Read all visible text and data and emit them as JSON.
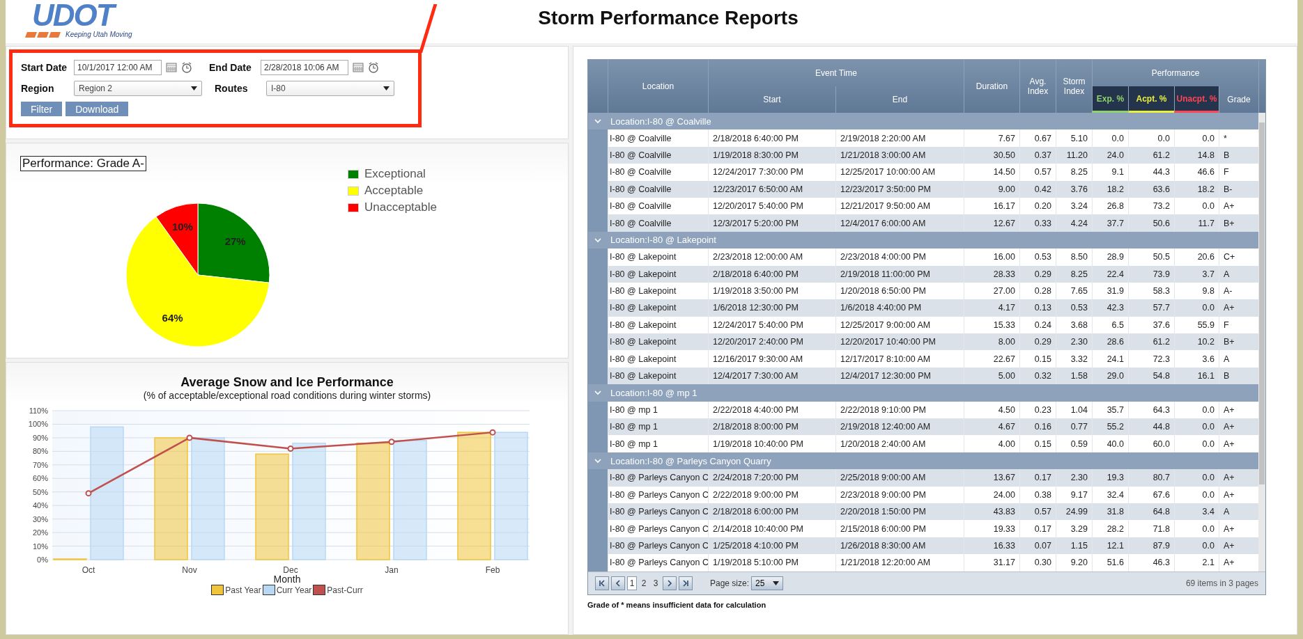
{
  "header": {
    "logo": "UDOT",
    "tagline": "Keeping Utah Moving",
    "title": "Storm Performance Reports"
  },
  "filters": {
    "start_date": {
      "label": "Start Date",
      "value": "10/1/2017 12:00 AM"
    },
    "end_date": {
      "label": "End Date",
      "value": "2/28/2018 10:06 AM"
    },
    "region": {
      "label": "Region",
      "value": "Region 2"
    },
    "routes": {
      "label": "Routes",
      "value": "I-80"
    },
    "buttons": [
      "Filter",
      "Download"
    ],
    "highlighted": true
  },
  "performance": {
    "title": "Performance: Grade A-",
    "chart_data": {
      "type": "pie",
      "categories": [
        "Exceptional",
        "Acceptable",
        "Unacceptable"
      ],
      "values": [
        27,
        64,
        10
      ],
      "value_labels": [
        "27%",
        "64%",
        "10%"
      ]
    },
    "slice_colors": [
      {
        "color": "#008000"
      },
      {
        "color": "#ffff00"
      },
      {
        "color": "#ff0000"
      }
    ]
  },
  "trend": {
    "subtitle": "(% of acceptable/exceptional road conditions during winter storms)",
    "chart_data": {
      "type": "bar",
      "title": "Average Snow and Ice Performance",
      "xlabel": "Month",
      "categories": [
        "Oct",
        "Nov",
        "Dec",
        "Jan",
        "Feb"
      ],
      "series": [
        {
          "name": "Past Year",
          "color": "#f0c43c",
          "type": "bar",
          "values": [
            0.5,
            90,
            78,
            86,
            94
          ]
        },
        {
          "name": "Curr Year",
          "color": "#b8d8f4",
          "type": "bar",
          "values": [
            98,
            90,
            86,
            88,
            94
          ]
        },
        {
          "name": "Past-Curr",
          "color": "#c0504d",
          "type": "line",
          "marker": "circle",
          "values": [
            49,
            90,
            82,
            87,
            94
          ]
        }
      ],
      "grid": true,
      "ylim": [
        0,
        110
      ],
      "yticks": [
        {
          "value": 0,
          "label": "0%"
        },
        {
          "value": 10,
          "label": "10%"
        },
        {
          "value": 20,
          "label": "20%"
        },
        {
          "value": 30,
          "label": "30%"
        },
        {
          "value": 40,
          "label": "40%"
        },
        {
          "value": 50,
          "label": "50%"
        },
        {
          "value": 60,
          "label": "60%"
        },
        {
          "value": 70,
          "label": "70%"
        },
        {
          "value": 80,
          "label": "80%"
        },
        {
          "value": 90,
          "label": "90%"
        },
        {
          "value": 100,
          "label": "100%"
        },
        {
          "value": 110,
          "label": "110%"
        }
      ]
    }
  },
  "table": {
    "columns": [
      {
        "label": "Location"
      },
      {
        "label": "Event Time",
        "subcolumns": [
          {
            "label": "Start"
          },
          {
            "label": "End"
          }
        ]
      },
      {
        "label": "Duration"
      },
      {
        "label": "Avg. Index"
      },
      {
        "label": "Storm Index"
      },
      {
        "label": "Performance",
        "subcolumns": [
          {
            "label": "Exp. %",
            "color": "#8fd36a"
          },
          {
            "label": "Acpt. %",
            "color": "#e8f03a"
          },
          {
            "label": "Unacpt. %",
            "color": "#ff4455"
          },
          {
            "label": "Grade"
          }
        ]
      }
    ],
    "groups": [
      {
        "label": "Location:I-80 @ Coalville",
        "expanded": true,
        "rows": [
          [
            "I-80 @ Coalville",
            "2/18/2018 6:40:00 PM",
            "2/19/2018 2:20:00 AM",
            "7.67",
            "0.67",
            "5.10",
            "0.0",
            "0.0",
            "0.0",
            "*"
          ],
          [
            "I-80 @ Coalville",
            "1/19/2018 8:30:00 PM",
            "1/21/2018 3:00:00 AM",
            "30.50",
            "0.37",
            "11.20",
            "24.0",
            "61.2",
            "14.8",
            "B"
          ],
          [
            "I-80 @ Coalville",
            "12/24/2017 7:30:00 PM",
            "12/25/2017 10:00:00 AM",
            "14.50",
            "0.57",
            "8.25",
            "9.1",
            "44.3",
            "46.6",
            "F"
          ],
          [
            "I-80 @ Coalville",
            "12/23/2017 6:50:00 AM",
            "12/23/2017 3:50:00 PM",
            "9.00",
            "0.42",
            "3.76",
            "18.2",
            "63.6",
            "18.2",
            "B-"
          ],
          [
            "I-80 @ Coalville",
            "12/20/2017 5:40:00 PM",
            "12/21/2017 9:50:00 AM",
            "16.17",
            "0.20",
            "3.24",
            "26.8",
            "73.2",
            "0.0",
            "A+"
          ],
          [
            "I-80 @ Coalville",
            "12/3/2017 5:20:00 PM",
            "12/4/2017 6:00:00 AM",
            "12.67",
            "0.33",
            "4.24",
            "37.7",
            "50.6",
            "11.7",
            "B+"
          ]
        ]
      },
      {
        "label": "Location:I-80 @ Lakepoint",
        "expanded": true,
        "rows": [
          [
            "I-80 @ Lakepoint",
            "2/23/2018 12:00:00 AM",
            "2/23/2018 4:00:00 PM",
            "16.00",
            "0.53",
            "8.50",
            "28.9",
            "50.5",
            "20.6",
            "C+"
          ],
          [
            "I-80 @ Lakepoint",
            "2/18/2018 6:40:00 PM",
            "2/19/2018 11:00:00 PM",
            "28.33",
            "0.29",
            "8.25",
            "22.4",
            "73.9",
            "3.7",
            "A"
          ],
          [
            "I-80 @ Lakepoint",
            "1/19/2018 3:50:00 PM",
            "1/20/2018 6:50:00 PM",
            "27.00",
            "0.28",
            "7.65",
            "31.9",
            "58.3",
            "9.8",
            "A-"
          ],
          [
            "I-80 @ Lakepoint",
            "1/6/2018 12:30:00 PM",
            "1/6/2018 4:40:00 PM",
            "4.17",
            "0.13",
            "0.53",
            "42.3",
            "57.7",
            "0.0",
            "A+"
          ],
          [
            "I-80 @ Lakepoint",
            "12/24/2017 5:40:00 PM",
            "12/25/2017 9:00:00 AM",
            "15.33",
            "0.24",
            "3.68",
            "6.5",
            "37.6",
            "55.9",
            "F"
          ],
          [
            "I-80 @ Lakepoint",
            "12/20/2017 2:40:00 PM",
            "12/20/2017 10:40:00 PM",
            "8.00",
            "0.29",
            "2.30",
            "28.6",
            "61.2",
            "10.2",
            "B+"
          ],
          [
            "I-80 @ Lakepoint",
            "12/16/2017 9:30:00 AM",
            "12/17/2017 8:10:00 AM",
            "22.67",
            "0.15",
            "3.32",
            "24.1",
            "72.3",
            "3.6",
            "A"
          ],
          [
            "I-80 @ Lakepoint",
            "12/4/2017 7:30:00 AM",
            "12/4/2017 12:30:00 PM",
            "5.00",
            "0.32",
            "1.58",
            "29.0",
            "54.8",
            "16.1",
            "B"
          ]
        ]
      },
      {
        "label": "Location:I-80 @ mp 1",
        "expanded": true,
        "rows": [
          [
            "I-80 @ mp 1",
            "2/22/2018 4:40:00 PM",
            "2/22/2018 9:10:00 PM",
            "4.50",
            "0.23",
            "1.04",
            "35.7",
            "64.3",
            "0.0",
            "A+"
          ],
          [
            "I-80 @ mp 1",
            "2/18/2018 8:00:00 PM",
            "2/19/2018 12:40:00 AM",
            "4.67",
            "0.16",
            "0.77",
            "55.2",
            "44.8",
            "0.0",
            "A+"
          ],
          [
            "I-80 @ mp 1",
            "1/19/2018 10:40:00 PM",
            "1/20/2018 2:40:00 AM",
            "4.00",
            "0.15",
            "0.59",
            "40.0",
            "60.0",
            "0.0",
            "A+"
          ]
        ]
      },
      {
        "label": "Location:I-80 @ Parleys Canyon Quarry",
        "expanded": true,
        "rows": [
          [
            "I-80 @ Parleys Canyon C",
            "2/24/2018 7:20:00 PM",
            "2/25/2018 9:00:00 AM",
            "13.67",
            "0.17",
            "2.30",
            "19.3",
            "80.7",
            "0.0",
            "A+"
          ],
          [
            "I-80 @ Parleys Canyon C",
            "2/22/2018 9:00:00 PM",
            "2/23/2018 9:00:00 PM",
            "24.00",
            "0.38",
            "9.17",
            "32.4",
            "67.6",
            "0.0",
            "A+"
          ],
          [
            "I-80 @ Parleys Canyon C",
            "2/18/2018 6:00:00 PM",
            "2/20/2018 1:50:00 PM",
            "43.83",
            "0.57",
            "24.99",
            "31.8",
            "64.8",
            "3.4",
            "A"
          ],
          [
            "I-80 @ Parleys Canyon C",
            "2/14/2018 10:40:00 PM",
            "2/15/2018 6:00:00 PM",
            "19.33",
            "0.17",
            "3.29",
            "28.2",
            "71.8",
            "0.0",
            "A+"
          ],
          [
            "I-80 @ Parleys Canyon C",
            "1/25/2018 4:10:00 PM",
            "1/26/2018 8:30:00 AM",
            "16.33",
            "0.07",
            "1.15",
            "12.1",
            "87.9",
            "0.0",
            "A+"
          ],
          [
            "I-80 @ Parleys Canyon C",
            "1/19/2018 5:10:00 PM",
            "1/21/2018 12:20:00 AM",
            "31.17",
            "0.30",
            "9.20",
            "51.6",
            "46.3",
            "2.1",
            "A+"
          ]
        ]
      }
    ],
    "pager": {
      "pages": [
        {
          "label": "1",
          "selected": true
        },
        {
          "label": "2",
          "selected": false
        },
        {
          "label": "3",
          "selected": false
        }
      ],
      "page_size_label": "Page size:",
      "page_size": "25",
      "summary": "69 items in 3 pages"
    },
    "note": "Grade of * means insufficient data for calculation"
  }
}
